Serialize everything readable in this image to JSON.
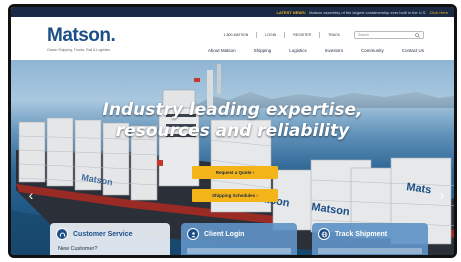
{
  "news": {
    "tag": "LATEST NEWS:",
    "text": "Matson assembly of the largest containership ever built in the U.S.",
    "more": "Click Here"
  },
  "header": {
    "logo": "Matson.",
    "tagline": "Ocean Shipping, Trucks, Rail & Logistics",
    "utility_links": [
      "1-800-MATSON",
      "LOGIN",
      "REGISTER",
      "TRACK"
    ],
    "search_placeholder": "Search",
    "nav": [
      "About Matson",
      "Shipping",
      "Logistics",
      "Investors",
      "Community",
      "Contact Us"
    ]
  },
  "hero": {
    "headline_line1": "Industry leading expertise,",
    "headline_line2": "resources and reliability",
    "cta_quote": "Request a Quote ›",
    "cta_schedule": "Shipping Schedules ›",
    "arrow_left": "‹",
    "arrow_right": "›"
  },
  "panels": {
    "customer_service": {
      "title": "Customer Service",
      "sub": "New Customer?"
    },
    "client_login": {
      "title": "Client Login"
    },
    "track_shipment": {
      "title": "Track Shipment"
    }
  },
  "colors": {
    "brand": "#1c4f87",
    "accent": "#f2b418",
    "newsbar": "#1a2a44"
  }
}
